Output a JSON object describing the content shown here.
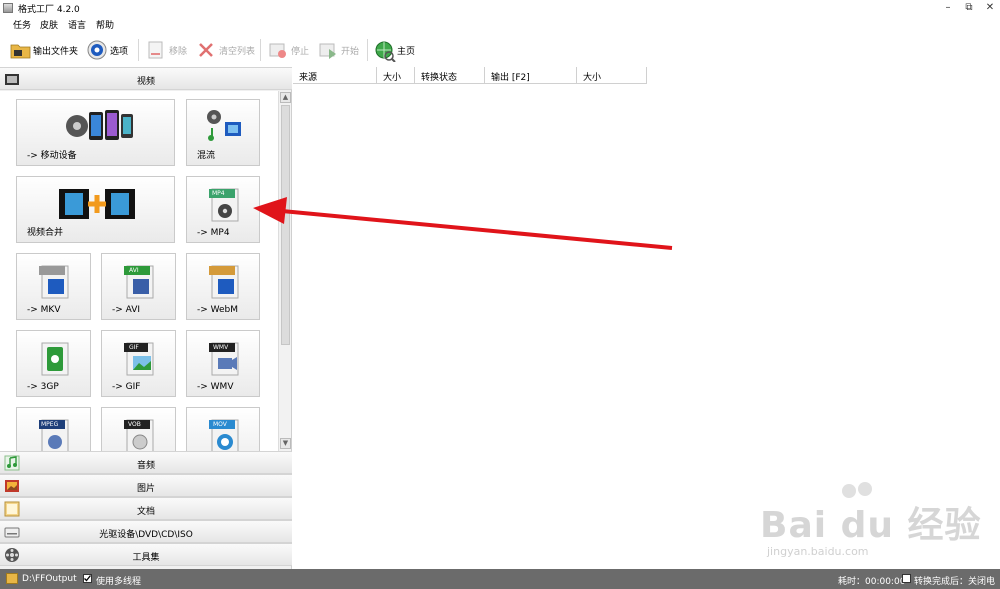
{
  "window": {
    "title": "格式工厂 4.2.0",
    "minimize": "–",
    "restore": "⧉",
    "close": "✕"
  },
  "menu": [
    "任务",
    "皮肤",
    "语言",
    "帮助"
  ],
  "toolbar": {
    "output_folder": "输出文件夹",
    "options": "选项",
    "remove": "移除",
    "clear_list": "清空列表",
    "stop": "停止",
    "start": "开始",
    "home": "主页"
  },
  "left": {
    "video_header": "视频",
    "tiles": [
      "-> 移动设备",
      "混流",
      "视频合并",
      "-> MP4",
      "-> MKV",
      "-> AVI",
      "-> WebM",
      "-> 3GP",
      "-> GIF",
      "-> WMV",
      "",
      "",
      ""
    ],
    "badges": {
      "mp4": "MP4",
      "avi": "AVI",
      "gif": "GIF",
      "wmv": "WMV",
      "mpeg": "MPEG",
      "vob": "VOB",
      "mov": "MOV"
    },
    "categories": {
      "audio": "音频",
      "image": "图片",
      "document": "文档",
      "rom": "光驱设备\\DVD\\CD\\ISO",
      "tools": "工具集"
    }
  },
  "task_list": {
    "columns": [
      "来源",
      "大小",
      "转换状态",
      "输出 [F2]",
      "大小"
    ]
  },
  "status": {
    "output_path": "D:\\FFOutput",
    "multithread": "使用多线程",
    "elapsed": "耗时：00:00:00",
    "after_done": "转换完成后：关闭电脑"
  },
  "watermark": {
    "logo": "Bai du 经验",
    "url": "jingyan.baidu.com"
  },
  "colors": {
    "arrow": "#e0141a",
    "status_bg": "#6b6b6b",
    "accent_blue": "#1e5bbf",
    "accent_green": "#2e9a3a",
    "accent_orange": "#f29a1d"
  }
}
